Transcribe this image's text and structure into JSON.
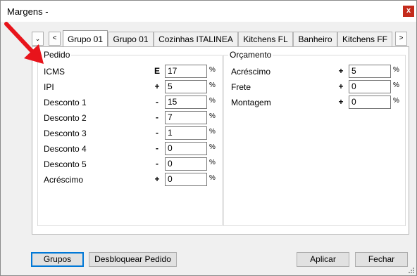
{
  "window": {
    "title": "Margens -",
    "close_label": "x"
  },
  "tabs": {
    "prev_label": "<",
    "next_label": ">",
    "items": [
      {
        "label": "Grupo 01",
        "active": true
      },
      {
        "label": "Grupo 01",
        "active": false
      },
      {
        "label": "Cozinhas ITALINEA",
        "active": false
      },
      {
        "label": "Kitchens FL",
        "active": false
      },
      {
        "label": "Banheiro",
        "active": false
      },
      {
        "label": "Kitchens FF",
        "active": false
      }
    ]
  },
  "pedido": {
    "title": "Pedido",
    "rows": [
      {
        "label": "ICMS",
        "sign": "E",
        "value": "17",
        "unit": "%"
      },
      {
        "label": "IPI",
        "sign": "+",
        "value": "5",
        "unit": "%"
      },
      {
        "label": "Desconto 1",
        "sign": "-",
        "value": "15",
        "unit": "%"
      },
      {
        "label": "Desconto 2",
        "sign": "-",
        "value": "7",
        "unit": "%"
      },
      {
        "label": "Desconto 3",
        "sign": "-",
        "value": "1",
        "unit": "%"
      },
      {
        "label": "Desconto 4",
        "sign": "-",
        "value": "0",
        "unit": "%"
      },
      {
        "label": "Desconto 5",
        "sign": "-",
        "value": "0",
        "unit": "%"
      },
      {
        "label": "Acréscimo",
        "sign": "+",
        "value": "0",
        "unit": "%"
      }
    ]
  },
  "orcamento": {
    "title": "Orçamento",
    "rows": [
      {
        "label": "Acréscimo",
        "sign": "+",
        "value": "5",
        "unit": "%"
      },
      {
        "label": "Frete",
        "sign": "+",
        "value": "0",
        "unit": "%"
      },
      {
        "label": "Montagem",
        "sign": "+",
        "value": "0",
        "unit": "%"
      }
    ]
  },
  "buttons": {
    "grupos": "Grupos",
    "desbloquear": "Desbloquear Pedido",
    "aplicar": "Aplicar",
    "fechar": "Fechar"
  },
  "colors": {
    "arrow": "#e8141b",
    "close": "#c42b1c",
    "focus": "#0078d7"
  }
}
